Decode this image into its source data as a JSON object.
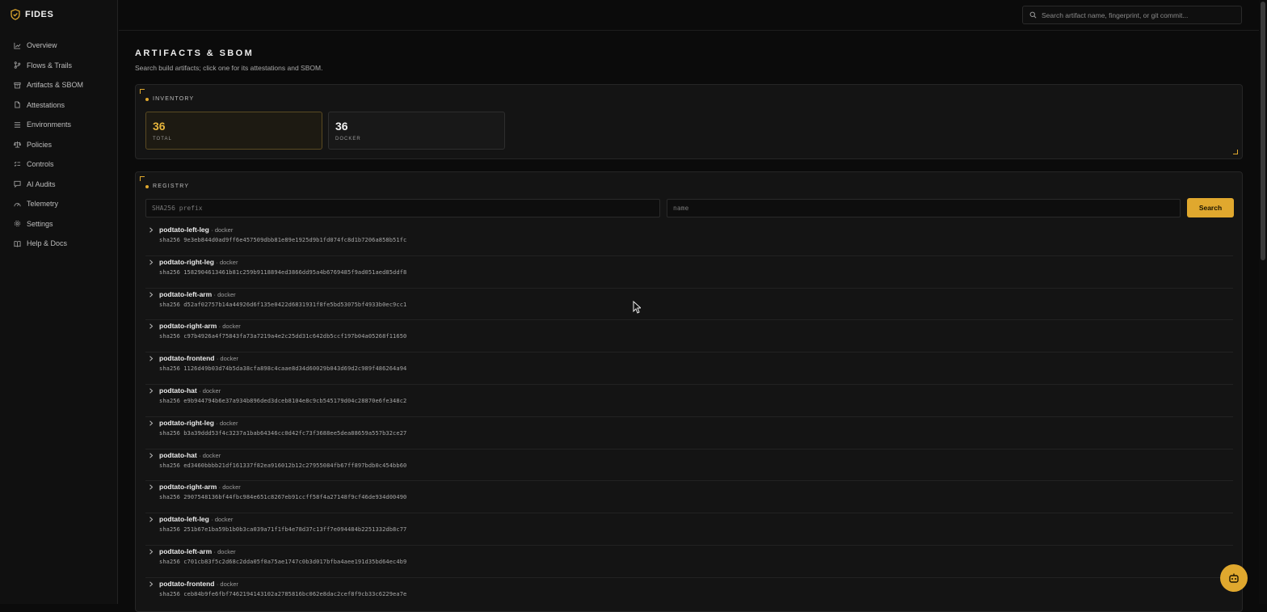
{
  "app": {
    "name": "FIDES"
  },
  "colors": {
    "accent": "#e0a82e",
    "background": "#0b0b0b",
    "panel": "#141414"
  },
  "sidebar": {
    "items": [
      {
        "label": "Overview",
        "icon": "chart-line-icon"
      },
      {
        "label": "Flows & Trails",
        "icon": "git-branch-icon"
      },
      {
        "label": "Artifacts & SBOM",
        "icon": "archive-box-icon"
      },
      {
        "label": "Attestations",
        "icon": "document-icon"
      },
      {
        "label": "Environments",
        "icon": "server-stack-icon"
      },
      {
        "label": "Policies",
        "icon": "scale-icon"
      },
      {
        "label": "Controls",
        "icon": "checklist-icon"
      },
      {
        "label": "AI Audits",
        "icon": "chat-bubble-icon"
      },
      {
        "label": "Telemetry",
        "icon": "gauge-icon"
      },
      {
        "label": "Settings",
        "icon": "gear-icon"
      },
      {
        "label": "Help & Docs",
        "icon": "book-icon"
      }
    ]
  },
  "topbar": {
    "search_placeholder": "Search artifact name, fingerprint, or git commit..."
  },
  "page": {
    "title": "ARTIFACTS & SBOM",
    "subtitle": "Search build artifacts; click one for its attestations and SBOM."
  },
  "inventory": {
    "label": "INVENTORY",
    "stats": [
      {
        "value": "36",
        "label": "TOTAL"
      },
      {
        "value": "36",
        "label": "DOCKER"
      }
    ]
  },
  "registry": {
    "label": "REGISTRY",
    "sha_placeholder": "SHA256 prefix",
    "name_placeholder": "name",
    "search_label": "Search",
    "rows": [
      {
        "name": "podtato-left-leg",
        "type": "· docker",
        "sha": "sha256 9e3eb844d0ad9ff6e457509dbb81e89e1925d9b1fd074fc8d1b7206a858b51fc"
      },
      {
        "name": "podtato-right-leg",
        "type": "· docker",
        "sha": "sha256 1582904613461b81c259b9118894ed3866dd95a4b6769485f9ad051aed85ddf8"
      },
      {
        "name": "podtato-left-arm",
        "type": "· docker",
        "sha": "sha256 d52af02757b14a44926d6f135e0422d6831931f8fe5bd53075bf4933b0ec9cc1"
      },
      {
        "name": "podtato-right-arm",
        "type": "· docker",
        "sha": "sha256 c97b4926a4f75843fa73a7219a4e2c25dd31c642db5ccf197b04a05268f11650"
      },
      {
        "name": "podtato-frontend",
        "type": "· docker",
        "sha": "sha256 1126d49b03d74b5da38cfa898c4caae8d34d60029b043d69d2c989f486264a94"
      },
      {
        "name": "podtato-hat",
        "type": "· docker",
        "sha": "sha256 e9b944794b6e37a934b896ded3dceb8104e8c9cb545179d04c28870e6fe348c2"
      },
      {
        "name": "podtato-right-leg",
        "type": "· docker",
        "sha": "sha256 b3a39ddd53f4c3237a1bab64346cc0d42fc73f3688ee5dea88659a557b32ce27"
      },
      {
        "name": "podtato-hat",
        "type": "· docker",
        "sha": "sha256 ed3460bbbb21df161337f82ea916012b12c27955084fb67ff897bdb0c454bb60"
      },
      {
        "name": "podtato-right-arm",
        "type": "· docker",
        "sha": "sha256 2907548136bf44fbc984e651c8267eb91ccff58f4a27148f9cf46de934d00490"
      },
      {
        "name": "podtato-left-leg",
        "type": "· docker",
        "sha": "sha256 251b67e1ba59b1b0b3ca039a71f1fb4e78d37c13ff7e094484b2251332db8c77"
      },
      {
        "name": "podtato-left-arm",
        "type": "· docker",
        "sha": "sha256 c701cb83f5c2d68c2dda05f0a75ae1747c0b3d017bfba4aee191d35bd64ec4b9"
      },
      {
        "name": "podtato-frontend",
        "type": "· docker",
        "sha": "sha256 ceb84b9fe6fbf7462194143102a2785816bc062e8dac2cef8f9cb33c6229ea7e"
      }
    ]
  },
  "assistant": {
    "icon": "robot-icon"
  }
}
